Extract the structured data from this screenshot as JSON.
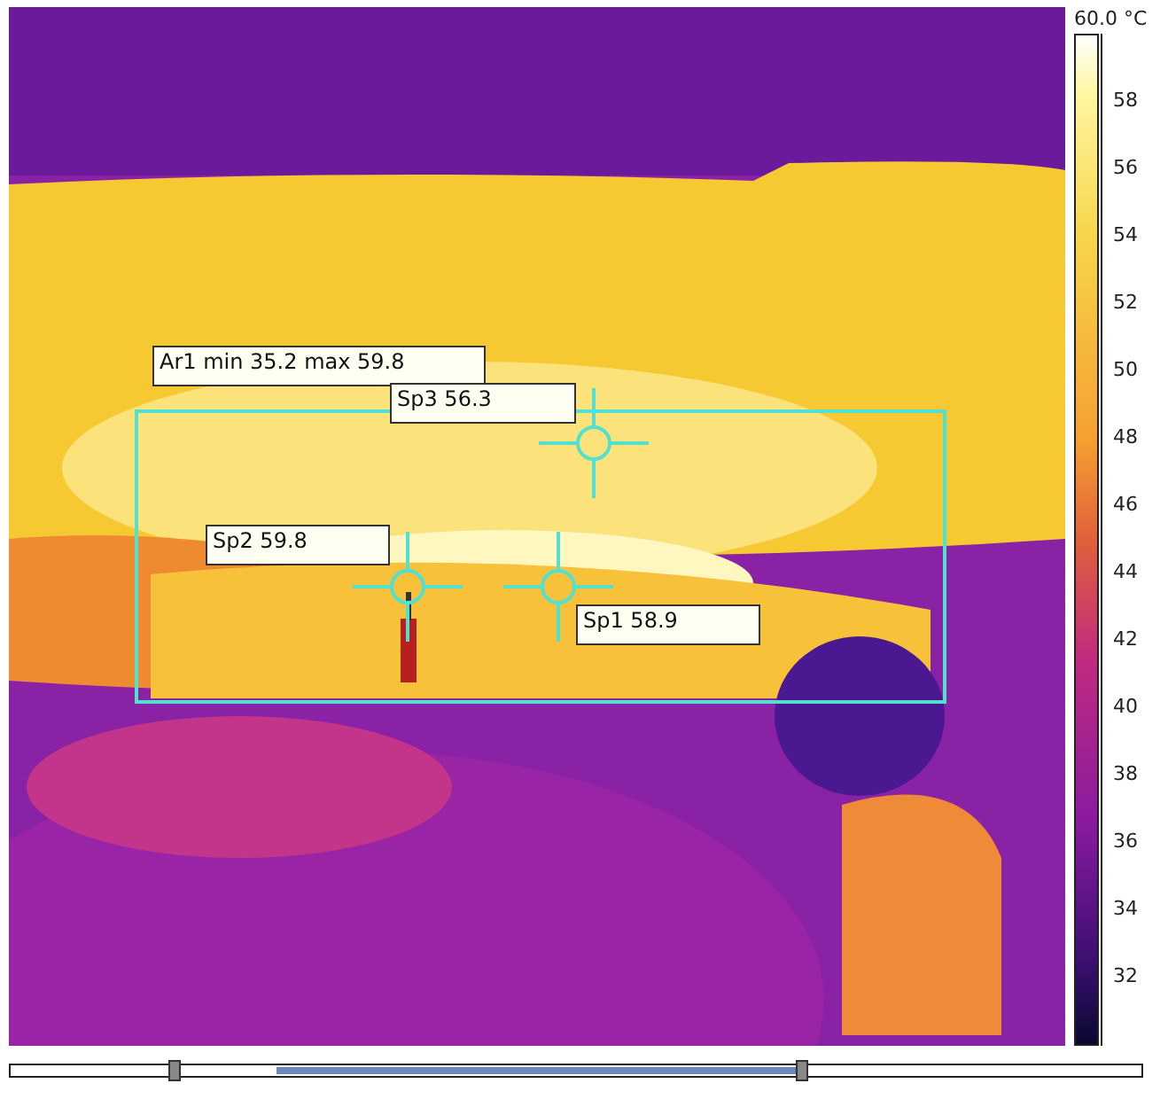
{
  "area": {
    "label": "Ar1 min 35.2 max 59.8"
  },
  "spots": [
    {
      "label": "Sp3 56.3"
    },
    {
      "label": "Sp2 59.8"
    },
    {
      "label": "Sp1 58.9"
    }
  ],
  "range": {
    "handles": [
      {
        "level": 0.14
      },
      {
        "level": 0.7
      }
    ]
  },
  "scale": {
    "max_label": "60.0 °C",
    "ticks": [
      "58",
      "56",
      "54",
      "52",
      "50",
      "48",
      "46",
      "44",
      "42",
      "40",
      "38",
      "36",
      "34",
      "32"
    ]
  }
}
